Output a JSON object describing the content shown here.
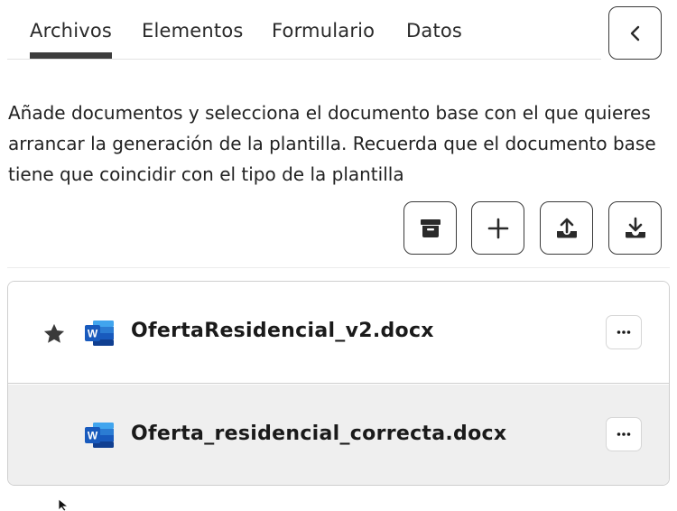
{
  "tabs": [
    {
      "label": "Archivos",
      "active": true
    },
    {
      "label": "Elementos",
      "active": false
    },
    {
      "label": "Formulario",
      "active": false
    },
    {
      "label": "Datos",
      "active": false
    }
  ],
  "collapse_button": {
    "icon": "chevron-left-icon"
  },
  "description": "Añade documentos y selecciona el documento base con el que quieres arrancar la generación de la plantilla. Recuerda que el documento base tiene que coincidir con el tipo de la plantilla",
  "actions": [
    {
      "icon": "archive-icon"
    },
    {
      "icon": "plus-icon"
    },
    {
      "icon": "upload-icon"
    },
    {
      "icon": "download-icon"
    }
  ],
  "files": [
    {
      "name": "OfertaResidencial_v2.docx",
      "base": true,
      "type": "word",
      "menu_icon": "more-horizontal-icon"
    },
    {
      "name": "Oferta_residencial_correcta.docx",
      "base": false,
      "type": "word",
      "menu_icon": "more-horizontal-icon"
    }
  ],
  "colors": {
    "word_dark": "#185ABD",
    "word_light": "#41A5EE",
    "border": "#3a3a3a",
    "selected_row": "#efefef"
  }
}
